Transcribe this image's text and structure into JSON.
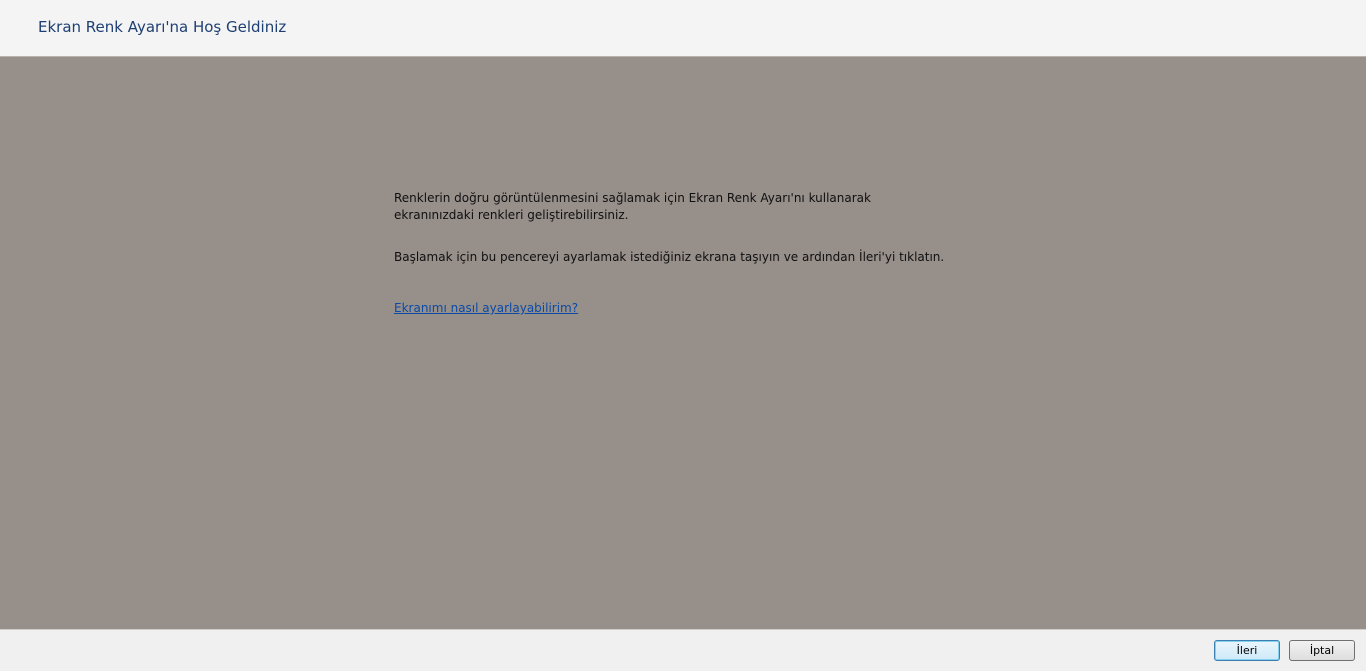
{
  "window": {
    "title": "Ekran Renk Ayarı'na Hoş Geldiniz"
  },
  "content": {
    "paragraph_1": "Renklerin doğru görüntülenmesini sağlamak için Ekran Renk Ayarı'nı kullanarak ekranınızdaki renkleri geliştirebilirsiniz.",
    "paragraph_2": "Başlamak için bu pencereyi ayarlamak istediğiniz ekrana taşıyın ve ardından İleri'yi tıklatın.",
    "help_link": "Ekranımı nasıl ayarlayabilirim?"
  },
  "footer": {
    "next_label": "İleri",
    "cancel_label": "İptal"
  },
  "colors": {
    "background": "#978f8a",
    "title_text": "#1e3f73",
    "link": "#0b4aa6"
  }
}
